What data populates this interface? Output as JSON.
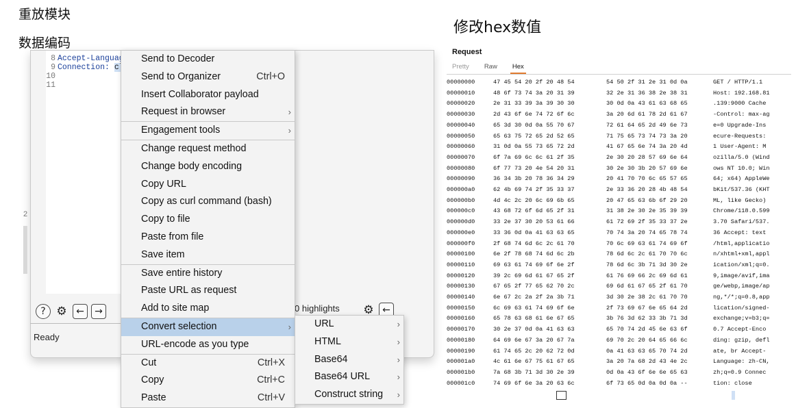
{
  "headings": {
    "replay_module": "重放模块",
    "data_encoding": "数据编码",
    "modify_hex": "修改hex数值"
  },
  "editor": {
    "lines": [
      {
        "num": "8",
        "key": "Accept-Languag",
        "rest": ""
      },
      {
        "num": "9",
        "key": "Connection:",
        "rest": "cl"
      },
      {
        "num": "10",
        "key": "",
        "rest": ""
      },
      {
        "num": "11",
        "key": "",
        "rest": ""
      }
    ],
    "gutter_number": "2"
  },
  "status": {
    "ready": "Ready",
    "highlights": "0 highlights"
  },
  "icons": {
    "help": "help-circle-icon",
    "settings": "gear-icon",
    "back": "arrow-left-icon",
    "forward": "arrow-right-icon"
  },
  "context_menu": {
    "items": [
      {
        "label": "Send to Decoder",
        "shortcut": "",
        "arrow": false,
        "sep_after": false,
        "active": false
      },
      {
        "label": "Send to Organizer",
        "shortcut": "Ctrl+O",
        "arrow": false,
        "sep_after": false,
        "active": false
      },
      {
        "label": "Insert Collaborator payload",
        "shortcut": "",
        "arrow": false,
        "sep_after": false,
        "active": false
      },
      {
        "label": "Request in browser",
        "shortcut": "",
        "arrow": true,
        "sep_after": true,
        "active": false
      },
      {
        "label": "Engagement tools",
        "shortcut": "",
        "arrow": true,
        "sep_after": true,
        "active": false
      },
      {
        "label": "Change request method",
        "shortcut": "",
        "arrow": false,
        "sep_after": false,
        "active": false
      },
      {
        "label": "Change body encoding",
        "shortcut": "",
        "arrow": false,
        "sep_after": false,
        "active": false
      },
      {
        "label": "Copy URL",
        "shortcut": "",
        "arrow": false,
        "sep_after": false,
        "active": false
      },
      {
        "label": "Copy as curl command (bash)",
        "shortcut": "",
        "arrow": false,
        "sep_after": false,
        "active": false
      },
      {
        "label": "Copy to file",
        "shortcut": "",
        "arrow": false,
        "sep_after": false,
        "active": false
      },
      {
        "label": "Paste from file",
        "shortcut": "",
        "arrow": false,
        "sep_after": false,
        "active": false
      },
      {
        "label": "Save item",
        "shortcut": "",
        "arrow": false,
        "sep_after": true,
        "active": false
      },
      {
        "label": "Save entire history",
        "shortcut": "",
        "arrow": false,
        "sep_after": false,
        "active": false
      },
      {
        "label": "Paste URL as request",
        "shortcut": "",
        "arrow": false,
        "sep_after": false,
        "active": false
      },
      {
        "label": "Add to site map",
        "shortcut": "",
        "arrow": false,
        "sep_after": true,
        "active": false
      },
      {
        "label": "Convert selection",
        "shortcut": "",
        "arrow": true,
        "sep_after": false,
        "active": true
      },
      {
        "label": "URL-encode as you type",
        "shortcut": "",
        "arrow": false,
        "sep_after": true,
        "active": false
      },
      {
        "label": "Cut",
        "shortcut": "Ctrl+X",
        "arrow": false,
        "sep_after": false,
        "active": false
      },
      {
        "label": "Copy",
        "shortcut": "Ctrl+C",
        "arrow": false,
        "sep_after": false,
        "active": false
      },
      {
        "label": "Paste",
        "shortcut": "Ctrl+V",
        "arrow": false,
        "sep_after": false,
        "active": false
      }
    ]
  },
  "sub_menu": {
    "items": [
      {
        "label": "URL"
      },
      {
        "label": "HTML"
      },
      {
        "label": "Base64"
      },
      {
        "label": "Base64 URL"
      },
      {
        "label": "Construct string"
      }
    ]
  },
  "request_panel": {
    "title": "Request",
    "tabs": [
      {
        "label": "Pretty",
        "state": "dim"
      },
      {
        "label": "Raw",
        "state": "normal"
      },
      {
        "label": "Hex",
        "state": "active"
      }
    ],
    "hex_rows": [
      {
        "off": "00000000",
        "b1": "47 45 54 20 2f 20 48 54",
        "b2": "54 50 2f 31 2e 31 0d 0a",
        "asc": "GET / HTTP/1.1"
      },
      {
        "off": "00000010",
        "b1": "48 6f 73 74 3a 20 31 39",
        "b2": "32 2e 31 36 38 2e 38 31",
        "asc": "Host: 192.168.81"
      },
      {
        "off": "00000020",
        "b1": "2e 31 33 39 3a 39 30 30",
        "b2": "30 0d 0a 43 61 63 68 65",
        "asc": ".139:9000 Cache"
      },
      {
        "off": "00000030",
        "b1": "2d 43 6f 6e 74 72 6f 6c",
        "b2": "3a 20 6d 61 78 2d 61 67",
        "asc": "-Control: max-ag"
      },
      {
        "off": "00000040",
        "b1": "65 3d 30 0d 0a 55 70 67",
        "b2": "72 61 64 65 2d 49 6e 73",
        "asc": "e=0 Upgrade-Ins"
      },
      {
        "off": "00000050",
        "b1": "65 63 75 72 65 2d 52 65",
        "b2": "71 75 65 73 74 73 3a 20",
        "asc": "ecure-Requests:"
      },
      {
        "off": "00000060",
        "b1": "31 0d 0a 55 73 65 72 2d",
        "b2": "41 67 65 6e 74 3a 20 4d",
        "asc": "1 User-Agent: M"
      },
      {
        "off": "00000070",
        "b1": "6f 7a 69 6c 6c 61 2f 35",
        "b2": "2e 30 20 28 57 69 6e 64",
        "asc": "ozilla/5.0 (Wind"
      },
      {
        "off": "00000080",
        "b1": "6f 77 73 20 4e 54 20 31",
        "b2": "30 2e 30 3b 20 57 69 6e",
        "asc": "ows NT 10.0; Win"
      },
      {
        "off": "00000090",
        "b1": "36 34 3b 20 78 36 34 29",
        "b2": "20 41 70 70 6c 65 57 65",
        "asc": "64; x64) AppleWe"
      },
      {
        "off": "000000a0",
        "b1": "62 4b 69 74 2f 35 33 37",
        "b2": "2e 33 36 20 28 4b 48 54",
        "asc": "bKit/537.36 (KHT"
      },
      {
        "off": "000000b0",
        "b1": "4d 4c 2c 20 6c 69 6b 65",
        "b2": "20 47 65 63 6b 6f 29 20",
        "asc": "ML, like Gecko)"
      },
      {
        "off": "000000c0",
        "b1": "43 68 72 6f 6d 65 2f 31",
        "b2": "31 38 2e 30 2e 35 39 39",
        "asc": "Chrome/118.0.599"
      },
      {
        "off": "000000d0",
        "b1": "33 2e 37 30 20 53 61 66",
        "b2": "61 72 69 2f 35 33 37 2e",
        "asc": "3.70 Safari/537."
      },
      {
        "off": "000000e0",
        "b1": "33 36 0d 0a 41 63 63 65",
        "b2": "70 74 3a 20 74 65 78 74",
        "asc": "36 Accept: text"
      },
      {
        "off": "000000f0",
        "b1": "2f 68 74 6d 6c 2c 61 70",
        "b2": "70 6c 69 63 61 74 69 6f",
        "asc": "/html,applicatio"
      },
      {
        "off": "00000100",
        "b1": "6e 2f 78 68 74 6d 6c 2b",
        "b2": "78 6d 6c 2c 61 70 70 6c",
        "asc": "n/xhtml+xml,appl"
      },
      {
        "off": "00000110",
        "b1": "69 63 61 74 69 6f 6e 2f",
        "b2": "78 6d 6c 3b 71 3d 30 2e",
        "asc": "ication/xml;q=0."
      },
      {
        "off": "00000120",
        "b1": "39 2c 69 6d 61 67 65 2f",
        "b2": "61 76 69 66 2c 69 6d 61",
        "asc": "9,image/avif,ima"
      },
      {
        "off": "00000130",
        "b1": "67 65 2f 77 65 62 70 2c",
        "b2": "69 6d 61 67 65 2f 61 70",
        "asc": "ge/webp,image/ap"
      },
      {
        "off": "00000140",
        "b1": "6e 67 2c 2a 2f 2a 3b 71",
        "b2": "3d 30 2e 38 2c 61 70 70",
        "asc": "ng,*/*;q=0.8,app"
      },
      {
        "off": "00000150",
        "b1": "6c 69 63 61 74 69 6f 6e",
        "b2": "2f 73 69 67 6e 65 64 2d",
        "asc": "lication/signed-"
      },
      {
        "off": "00000160",
        "b1": "65 78 63 68 61 6e 67 65",
        "b2": "3b 76 3d 62 33 3b 71 3d",
        "asc": "exchange;v=b3;q="
      },
      {
        "off": "00000170",
        "b1": "30 2e 37 0d 0a 41 63 63",
        "b2": "65 70 74 2d 45 6e 63 6f",
        "asc": "0.7 Accept-Enco"
      },
      {
        "off": "00000180",
        "b1": "64 69 6e 67 3a 20 67 7a",
        "b2": "69 70 2c 20 64 65 66 6c",
        "asc": "ding: gzip, defl"
      },
      {
        "off": "00000190",
        "b1": "61 74 65 2c 20 62 72 0d",
        "b2": "0a 41 63 63 65 70 74 2d",
        "asc": "ate, br Accept-"
      },
      {
        "off": "000001a0",
        "b1": "4c 61 6e 67 75 61 67 65",
        "b2": "3a 20 7a 68 2d 43 4e 2c",
        "asc": "Language: zh-CN,"
      },
      {
        "off": "000001b0",
        "b1": "7a 68 3b 71 3d 30 2e 39",
        "b2": "0d 0a 43 6f 6e 6e 65 63",
        "asc": "zh;q=0.9 Connec"
      },
      {
        "off": "000001c0",
        "b1": "74 69 6f 6e 3a 20 63 6c",
        "b2": "6f 73 65 0d 0a 0d 0a --",
        "asc": "tion: close"
      }
    ]
  }
}
